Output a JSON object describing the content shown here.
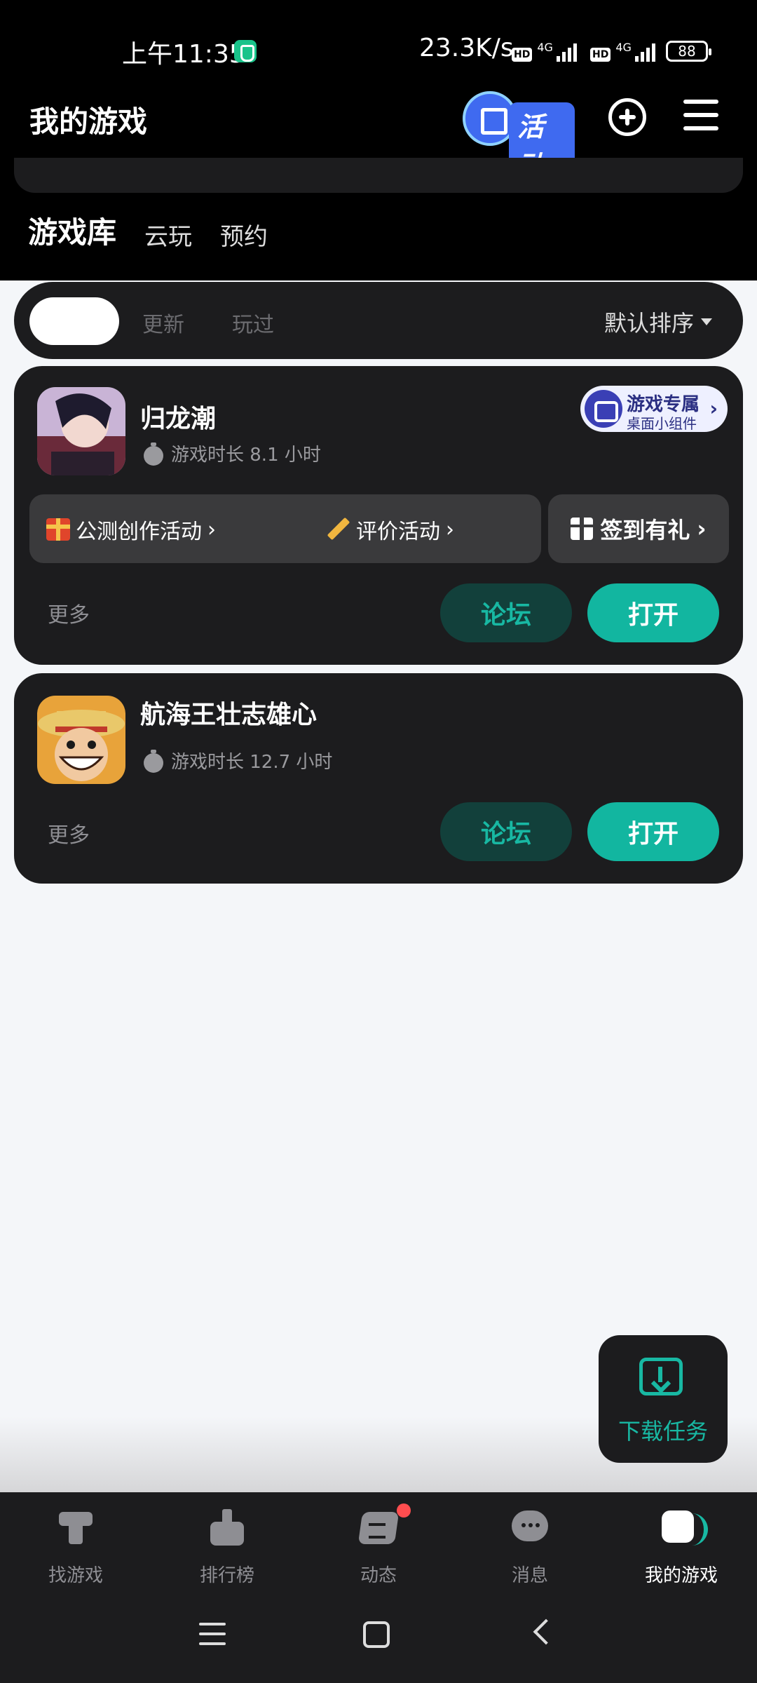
{
  "status": {
    "time": "上午11:35",
    "net_speed": "23.3K/s",
    "battery": "88"
  },
  "header": {
    "title": "我的游戏",
    "activity_label": "活动"
  },
  "tabs": [
    "游戏库",
    "云玩",
    "预约"
  ],
  "filter": {
    "options": [
      "更新",
      "玩过"
    ],
    "sort_label": "默认排序"
  },
  "games": [
    {
      "name": "归龙潮",
      "playtime": "游戏时长 8.1 小时",
      "widget_title": "游戏专属",
      "widget_subtitle": "桌面小组件",
      "events": [
        "公测创作活动",
        "评价活动"
      ],
      "signin": "签到有礼",
      "more": "更多",
      "forum": "论坛",
      "open": "打开"
    },
    {
      "name": "航海王壮志雄心",
      "playtime": "游戏时长 12.7 小时",
      "more": "更多",
      "forum": "论坛",
      "open": "打开"
    }
  ],
  "fab": {
    "label": "下载任务"
  },
  "bottom_nav": [
    "找游戏",
    "排行榜",
    "动态",
    "消息",
    "我的游戏"
  ],
  "colors": {
    "accent": "#12b6a0",
    "forum_bg": "#12403b",
    "card_bg": "#1c1c1e",
    "page_bg": "#f4f6f9"
  }
}
